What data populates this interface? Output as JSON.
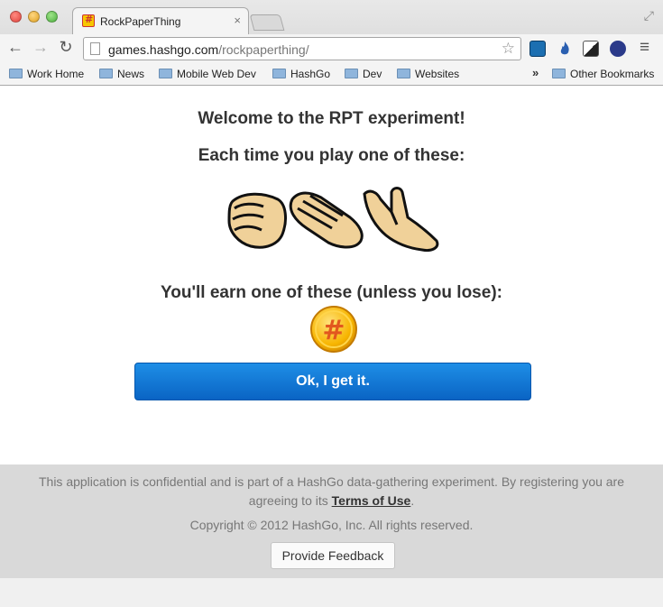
{
  "browser": {
    "tab_title": "RockPaperThing",
    "tab_close": "×",
    "url_host": "games.hashgo.com",
    "url_path": "/rockpaperthing/",
    "nav_back": "←",
    "nav_forward": "→",
    "nav_reload": "↻",
    "star": "☆",
    "menu": "≡",
    "fullscreen": "⤢",
    "bookmarks": [
      "Work Home",
      "News",
      "Mobile Web Dev",
      "HashGo",
      "Dev",
      "Websites"
    ],
    "bookmarks_more": "»",
    "other_bookmarks": "Other Bookmarks"
  },
  "page": {
    "welcome": "Welcome to the RPT experiment!",
    "each_time": "Each time you play one of these:",
    "earn": "You'll earn one of these (unless you lose):",
    "ok_button": "Ok, I get it.",
    "coin_symbol": "#"
  },
  "footer": {
    "text_before": "This application is confidential and is part of a HashGo data-gathering experiment. By registering you are agreeing to its ",
    "terms_link": "Terms of Use",
    "text_after": ".",
    "copyright": "Copyright © 2012 HashGo, Inc. All rights reserved.",
    "feedback_button": "Provide Feedback"
  },
  "colors": {
    "primary_button": "#0a64c4",
    "footer_bg": "#d9d9d9",
    "coin": "#f7b500"
  }
}
